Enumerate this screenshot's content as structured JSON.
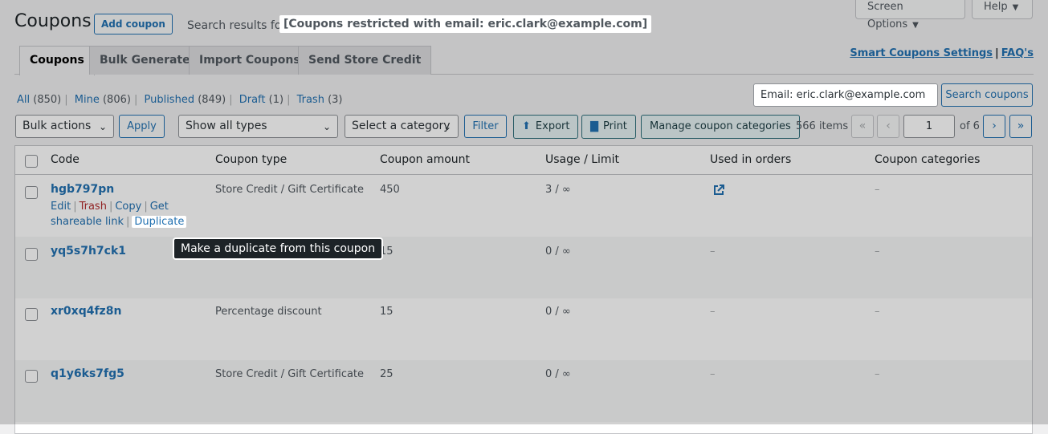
{
  "header": {
    "title": "Coupons",
    "add_button": "Add coupon",
    "search_label": "Search results for:",
    "search_term": "[Coupons restricted with email: eric.clark@example.com]",
    "screen_options": "Screen Options",
    "help": "Help"
  },
  "tabs": [
    "Coupons",
    "Bulk Generate",
    "Import Coupons",
    "Send Store Credit"
  ],
  "links": {
    "settings": "Smart Coupons Settings",
    "separator": "|",
    "faqs": "FAQ's"
  },
  "views": [
    {
      "label": "All",
      "count": "(850)"
    },
    {
      "label": "Mine",
      "count": "(806)"
    },
    {
      "label": "Published",
      "count": "(849)"
    },
    {
      "label": "Draft",
      "count": "(1)"
    },
    {
      "label": "Trash",
      "count": "(3)"
    }
  ],
  "search": {
    "value": "Email: eric.clark@example.com",
    "button": "Search coupons"
  },
  "toolbar": {
    "bulk_actions": "Bulk actions",
    "apply": "Apply",
    "type_filter": "Show all types",
    "category_filter": "Select a category",
    "filter": "Filter",
    "export": "Export",
    "print": "Print",
    "manage_categories": "Manage coupon categories"
  },
  "pagination": {
    "items": "566 items",
    "first": "«",
    "prev": "‹",
    "current_page": "1",
    "of": "of 6",
    "next": "›",
    "last": "»"
  },
  "table": {
    "columns": [
      "Code",
      "Coupon type",
      "Coupon amount",
      "Usage / Limit",
      "Used in orders",
      "Coupon categories"
    ],
    "rows": [
      {
        "code": "hgb797pn",
        "type": "Store Credit / Gift Certificate",
        "amount": "450",
        "usage": "3 / ∞",
        "orders": "",
        "categories": "–"
      },
      {
        "code": "yq5s7h7ck1",
        "type": "",
        "amount": "15",
        "usage": "0 / ∞",
        "orders": "–",
        "categories": "–"
      },
      {
        "code": "xr0xq4fz8n",
        "type": "Percentage discount",
        "amount": "15",
        "usage": "0 / ∞",
        "orders": "–",
        "categories": "–"
      },
      {
        "code": "q1y6ks7fg5",
        "type": "Store Credit / Gift Certificate",
        "amount": "25",
        "usage": "0 / ∞",
        "orders": "–",
        "categories": "–"
      }
    ],
    "row_actions": {
      "edit": "Edit",
      "trash": "Trash",
      "copy": "Copy",
      "get": "Get",
      "shareable": "shareable link",
      "duplicate": "Duplicate"
    }
  },
  "tooltip": "Make a duplicate from this coupon"
}
